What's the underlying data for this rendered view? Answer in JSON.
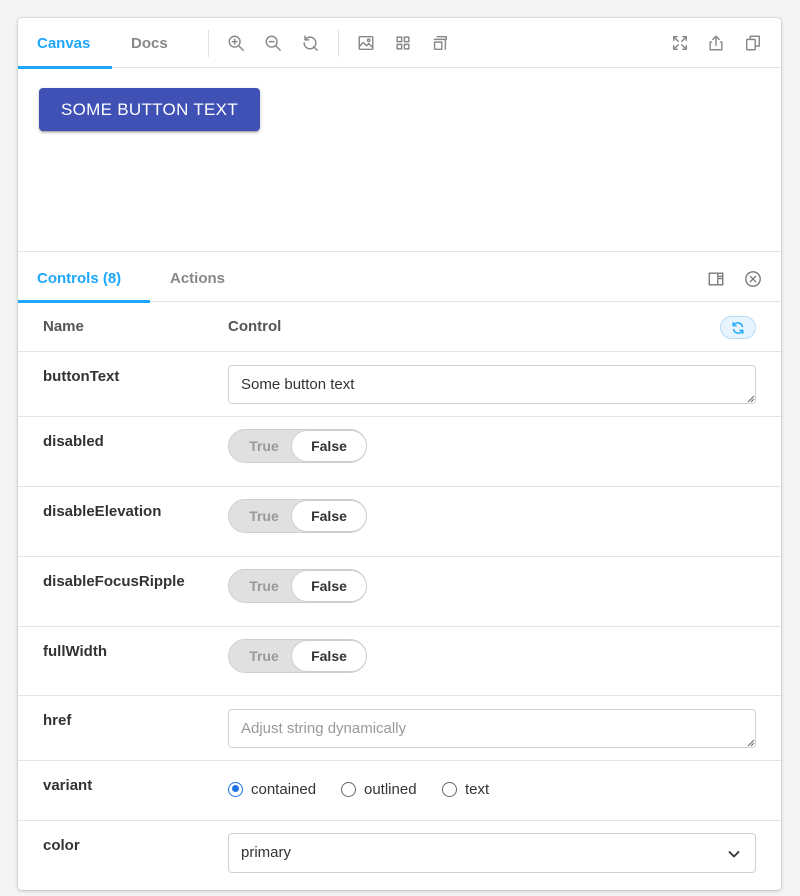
{
  "toolbar": {
    "tabs": [
      {
        "label": "Canvas",
        "active": true
      },
      {
        "label": "Docs",
        "active": false
      }
    ],
    "icons": [
      "zoom-in-icon",
      "zoom-out-icon",
      "reset-zoom-icon",
      "background-icon",
      "grid-icon",
      "outline-icon",
      "fullscreen-icon",
      "share-icon",
      "copy-icon"
    ]
  },
  "preview": {
    "button_text": "SOME BUTTON TEXT",
    "button_color": "#3f51b5"
  },
  "panel": {
    "tabs": [
      {
        "label": "Controls (8)",
        "active": true
      },
      {
        "label": "Actions",
        "active": false
      }
    ],
    "accent": "#1ea7fd"
  },
  "controls": {
    "header": {
      "name": "Name",
      "control": "Control"
    },
    "rows": [
      {
        "name": "buttonText",
        "type": "text",
        "value": "Some button text",
        "placeholder": ""
      },
      {
        "name": "disabled",
        "type": "boolean",
        "true_label": "True",
        "false_label": "False",
        "value": false
      },
      {
        "name": "disableElevation",
        "type": "boolean",
        "true_label": "True",
        "false_label": "False",
        "value": false
      },
      {
        "name": "disableFocusRipple",
        "type": "boolean",
        "true_label": "True",
        "false_label": "False",
        "value": false
      },
      {
        "name": "fullWidth",
        "type": "boolean",
        "true_label": "True",
        "false_label": "False",
        "value": false
      },
      {
        "name": "href",
        "type": "text",
        "value": "",
        "placeholder": "Adjust string dynamically"
      },
      {
        "name": "variant",
        "type": "radio",
        "options": [
          "contained",
          "outlined",
          "text"
        ],
        "value": "contained"
      },
      {
        "name": "color",
        "type": "select",
        "value": "primary"
      }
    ]
  }
}
